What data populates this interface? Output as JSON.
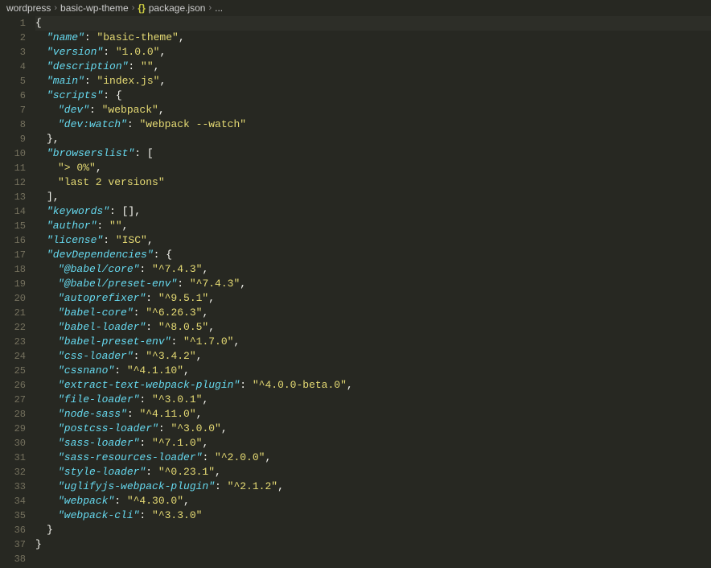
{
  "breadcrumb": {
    "parts": [
      "wordpress",
      "basic-wp-theme",
      "package.json",
      "..."
    ],
    "file_icon": "{}"
  },
  "code": {
    "lines": [
      {
        "n": 1,
        "indent": 0,
        "tokens": [
          {
            "t": "punc",
            "v": "{"
          }
        ],
        "hl": true
      },
      {
        "n": 2,
        "indent": 1,
        "tokens": [
          {
            "t": "key",
            "v": "\"name\""
          },
          {
            "t": "punc",
            "v": ": "
          },
          {
            "t": "str",
            "v": "\"basic-theme\""
          },
          {
            "t": "punc",
            "v": ","
          }
        ]
      },
      {
        "n": 3,
        "indent": 1,
        "tokens": [
          {
            "t": "key",
            "v": "\"version\""
          },
          {
            "t": "punc",
            "v": ": "
          },
          {
            "t": "str",
            "v": "\"1.0.0\""
          },
          {
            "t": "punc",
            "v": ","
          }
        ]
      },
      {
        "n": 4,
        "indent": 1,
        "tokens": [
          {
            "t": "key",
            "v": "\"description\""
          },
          {
            "t": "punc",
            "v": ": "
          },
          {
            "t": "str",
            "v": "\"\""
          },
          {
            "t": "punc",
            "v": ","
          }
        ]
      },
      {
        "n": 5,
        "indent": 1,
        "tokens": [
          {
            "t": "key",
            "v": "\"main\""
          },
          {
            "t": "punc",
            "v": ": "
          },
          {
            "t": "str",
            "v": "\"index.js\""
          },
          {
            "t": "punc",
            "v": ","
          }
        ]
      },
      {
        "n": 6,
        "indent": 1,
        "tokens": [
          {
            "t": "key",
            "v": "\"scripts\""
          },
          {
            "t": "punc",
            "v": ": {"
          }
        ]
      },
      {
        "n": 7,
        "indent": 2,
        "tokens": [
          {
            "t": "key",
            "v": "\"dev\""
          },
          {
            "t": "punc",
            "v": ": "
          },
          {
            "t": "str",
            "v": "\"webpack\""
          },
          {
            "t": "punc",
            "v": ","
          }
        ]
      },
      {
        "n": 8,
        "indent": 2,
        "tokens": [
          {
            "t": "key",
            "v": "\"dev:watch\""
          },
          {
            "t": "punc",
            "v": ": "
          },
          {
            "t": "str",
            "v": "\"webpack --watch\""
          }
        ]
      },
      {
        "n": 9,
        "indent": 1,
        "tokens": [
          {
            "t": "punc",
            "v": "},"
          }
        ]
      },
      {
        "n": 10,
        "indent": 1,
        "tokens": [
          {
            "t": "key",
            "v": "\"browserslist\""
          },
          {
            "t": "punc",
            "v": ": ["
          }
        ]
      },
      {
        "n": 11,
        "indent": 2,
        "tokens": [
          {
            "t": "str",
            "v": "\"> 0%\""
          },
          {
            "t": "punc",
            "v": ","
          }
        ]
      },
      {
        "n": 12,
        "indent": 2,
        "tokens": [
          {
            "t": "str",
            "v": "\"last 2 versions\""
          }
        ]
      },
      {
        "n": 13,
        "indent": 1,
        "tokens": [
          {
            "t": "punc",
            "v": "],"
          }
        ]
      },
      {
        "n": 14,
        "indent": 1,
        "tokens": [
          {
            "t": "key",
            "v": "\"keywords\""
          },
          {
            "t": "punc",
            "v": ": [],"
          }
        ]
      },
      {
        "n": 15,
        "indent": 1,
        "tokens": [
          {
            "t": "key",
            "v": "\"author\""
          },
          {
            "t": "punc",
            "v": ": "
          },
          {
            "t": "str",
            "v": "\"\""
          },
          {
            "t": "punc",
            "v": ","
          }
        ]
      },
      {
        "n": 16,
        "indent": 1,
        "tokens": [
          {
            "t": "key",
            "v": "\"license\""
          },
          {
            "t": "punc",
            "v": ": "
          },
          {
            "t": "str",
            "v": "\"ISC\""
          },
          {
            "t": "punc",
            "v": ","
          }
        ]
      },
      {
        "n": 17,
        "indent": 1,
        "tokens": [
          {
            "t": "key",
            "v": "\"devDependencies\""
          },
          {
            "t": "punc",
            "v": ": {"
          }
        ]
      },
      {
        "n": 18,
        "indent": 2,
        "tokens": [
          {
            "t": "key",
            "v": "\"@babel/core\""
          },
          {
            "t": "punc",
            "v": ": "
          },
          {
            "t": "str",
            "v": "\"^7.4.3\""
          },
          {
            "t": "punc",
            "v": ","
          }
        ]
      },
      {
        "n": 19,
        "indent": 2,
        "tokens": [
          {
            "t": "key",
            "v": "\"@babel/preset-env\""
          },
          {
            "t": "punc",
            "v": ": "
          },
          {
            "t": "str",
            "v": "\"^7.4.3\""
          },
          {
            "t": "punc",
            "v": ","
          }
        ]
      },
      {
        "n": 20,
        "indent": 2,
        "tokens": [
          {
            "t": "key",
            "v": "\"autoprefixer\""
          },
          {
            "t": "punc",
            "v": ": "
          },
          {
            "t": "str",
            "v": "\"^9.5.1\""
          },
          {
            "t": "punc",
            "v": ","
          }
        ]
      },
      {
        "n": 21,
        "indent": 2,
        "tokens": [
          {
            "t": "key",
            "v": "\"babel-core\""
          },
          {
            "t": "punc",
            "v": ": "
          },
          {
            "t": "str",
            "v": "\"^6.26.3\""
          },
          {
            "t": "punc",
            "v": ","
          }
        ]
      },
      {
        "n": 22,
        "indent": 2,
        "tokens": [
          {
            "t": "key",
            "v": "\"babel-loader\""
          },
          {
            "t": "punc",
            "v": ": "
          },
          {
            "t": "str",
            "v": "\"^8.0.5\""
          },
          {
            "t": "punc",
            "v": ","
          }
        ]
      },
      {
        "n": 23,
        "indent": 2,
        "tokens": [
          {
            "t": "key",
            "v": "\"babel-preset-env\""
          },
          {
            "t": "punc",
            "v": ": "
          },
          {
            "t": "str",
            "v": "\"^1.7.0\""
          },
          {
            "t": "punc",
            "v": ","
          }
        ]
      },
      {
        "n": 24,
        "indent": 2,
        "tokens": [
          {
            "t": "key",
            "v": "\"css-loader\""
          },
          {
            "t": "punc",
            "v": ": "
          },
          {
            "t": "str",
            "v": "\"^3.4.2\""
          },
          {
            "t": "punc",
            "v": ","
          }
        ]
      },
      {
        "n": 25,
        "indent": 2,
        "tokens": [
          {
            "t": "key",
            "v": "\"cssnano\""
          },
          {
            "t": "punc",
            "v": ": "
          },
          {
            "t": "str",
            "v": "\"^4.1.10\""
          },
          {
            "t": "punc",
            "v": ","
          }
        ]
      },
      {
        "n": 26,
        "indent": 2,
        "tokens": [
          {
            "t": "key",
            "v": "\"extract-text-webpack-plugin\""
          },
          {
            "t": "punc",
            "v": ": "
          },
          {
            "t": "str",
            "v": "\"^4.0.0-beta.0\""
          },
          {
            "t": "punc",
            "v": ","
          }
        ]
      },
      {
        "n": 27,
        "indent": 2,
        "tokens": [
          {
            "t": "key",
            "v": "\"file-loader\""
          },
          {
            "t": "punc",
            "v": ": "
          },
          {
            "t": "str",
            "v": "\"^3.0.1\""
          },
          {
            "t": "punc",
            "v": ","
          }
        ]
      },
      {
        "n": 28,
        "indent": 2,
        "tokens": [
          {
            "t": "key",
            "v": "\"node-sass\""
          },
          {
            "t": "punc",
            "v": ": "
          },
          {
            "t": "str",
            "v": "\"^4.11.0\""
          },
          {
            "t": "punc",
            "v": ","
          }
        ]
      },
      {
        "n": 29,
        "indent": 2,
        "tokens": [
          {
            "t": "key",
            "v": "\"postcss-loader\""
          },
          {
            "t": "punc",
            "v": ": "
          },
          {
            "t": "str",
            "v": "\"^3.0.0\""
          },
          {
            "t": "punc",
            "v": ","
          }
        ]
      },
      {
        "n": 30,
        "indent": 2,
        "tokens": [
          {
            "t": "key",
            "v": "\"sass-loader\""
          },
          {
            "t": "punc",
            "v": ": "
          },
          {
            "t": "str",
            "v": "\"^7.1.0\""
          },
          {
            "t": "punc",
            "v": ","
          }
        ]
      },
      {
        "n": 31,
        "indent": 2,
        "tokens": [
          {
            "t": "key",
            "v": "\"sass-resources-loader\""
          },
          {
            "t": "punc",
            "v": ": "
          },
          {
            "t": "str",
            "v": "\"^2.0.0\""
          },
          {
            "t": "punc",
            "v": ","
          }
        ]
      },
      {
        "n": 32,
        "indent": 2,
        "tokens": [
          {
            "t": "key",
            "v": "\"style-loader\""
          },
          {
            "t": "punc",
            "v": ": "
          },
          {
            "t": "str",
            "v": "\"^0.23.1\""
          },
          {
            "t": "punc",
            "v": ","
          }
        ]
      },
      {
        "n": 33,
        "indent": 2,
        "tokens": [
          {
            "t": "key",
            "v": "\"uglifyjs-webpack-plugin\""
          },
          {
            "t": "punc",
            "v": ": "
          },
          {
            "t": "str",
            "v": "\"^2.1.2\""
          },
          {
            "t": "punc",
            "v": ","
          }
        ]
      },
      {
        "n": 34,
        "indent": 2,
        "tokens": [
          {
            "t": "key",
            "v": "\"webpack\""
          },
          {
            "t": "punc",
            "v": ": "
          },
          {
            "t": "str",
            "v": "\"^4.30.0\""
          },
          {
            "t": "punc",
            "v": ","
          }
        ]
      },
      {
        "n": 35,
        "indent": 2,
        "tokens": [
          {
            "t": "key",
            "v": "\"webpack-cli\""
          },
          {
            "t": "punc",
            "v": ": "
          },
          {
            "t": "str",
            "v": "\"^3.3.0\""
          }
        ]
      },
      {
        "n": 36,
        "indent": 1,
        "tokens": [
          {
            "t": "punc",
            "v": "}"
          }
        ]
      },
      {
        "n": 37,
        "indent": 0,
        "tokens": [
          {
            "t": "punc",
            "v": "}"
          }
        ]
      },
      {
        "n": 38,
        "indent": 0,
        "tokens": []
      }
    ]
  }
}
